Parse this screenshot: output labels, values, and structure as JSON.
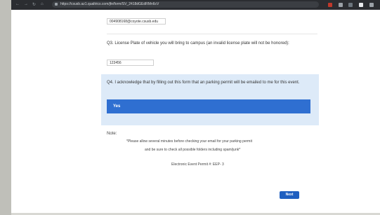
{
  "browser": {
    "url": "https://csusb.az1.qualtrics.com/jfe/form/SV_2418dGEdRMn6cV"
  },
  "form": {
    "email_value": "004908168@coyote.csusb.edu",
    "q3_label": "Q3. License Plate of vehicle you will bring to campus (an invalid license plate will not be honored):",
    "plate_value": "123456",
    "q4_label": "Q4. I acknowledge that by filling out this form that an parking permit will be emailed to me for this event.",
    "q4_option": "Yes",
    "note_title": "Note:",
    "note_line1": "*Please allow several minutes before checking your email for your parking permit",
    "note_line2": "and be sure to check all possible folders including spam/junk*",
    "permit_number": "Electronic Event Permit #: EEP- 3",
    "next_label": "Next"
  },
  "colors": {
    "accent": "#2f6fd1",
    "selected_bg": "#ddeaf8"
  }
}
